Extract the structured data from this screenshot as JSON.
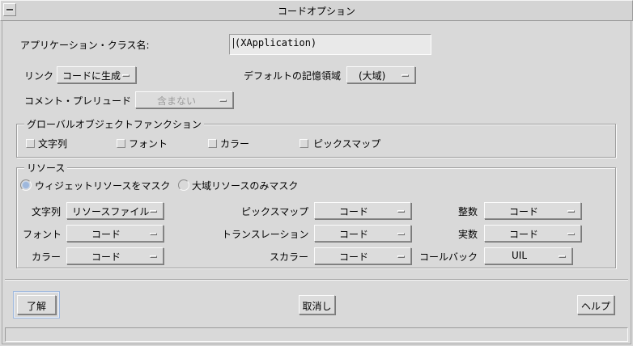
{
  "window": {
    "title": "コードオプション"
  },
  "app_class": {
    "label": "アプリケーション・クラス名:",
    "value": "(XApplication)"
  },
  "link": {
    "label": "リンク",
    "value": "コードに生成"
  },
  "default_storage": {
    "label": "デフォルトの記憶領域",
    "value": "(大域)"
  },
  "comment_prelude": {
    "label": "コメント・プレリュード",
    "value": "含まない"
  },
  "global_functions": {
    "title": "グローバルオブジェクトファンクション",
    "items": [
      "文字列",
      "フォント",
      "カラー",
      "ピックスマップ"
    ]
  },
  "resources": {
    "title": "リソース",
    "radios": [
      {
        "label": "ウィジェットリソースをマスク",
        "selected": true
      },
      {
        "label": "大域リソースのみマスク",
        "selected": false
      }
    ],
    "rows": [
      [
        {
          "label": "文字列",
          "value": "リソースファイル"
        },
        {
          "label": "ピックスマップ",
          "value": "コード"
        },
        {
          "label": "整数",
          "value": "コード"
        }
      ],
      [
        {
          "label": "フォント",
          "value": "コード"
        },
        {
          "label": "トランスレーション",
          "value": "コード"
        },
        {
          "label": "実数",
          "value": "コード"
        }
      ],
      [
        {
          "label": "カラー",
          "value": "コード"
        },
        {
          "label": "スカラー",
          "value": "コード"
        },
        {
          "label": "コールバック",
          "value": "UIL"
        }
      ]
    ]
  },
  "buttons": {
    "ok": "了解",
    "cancel": "取消し",
    "help": "ヘルプ"
  },
  "colors": {
    "background": "#d9d9d9",
    "accent": "#9fb8dc"
  }
}
